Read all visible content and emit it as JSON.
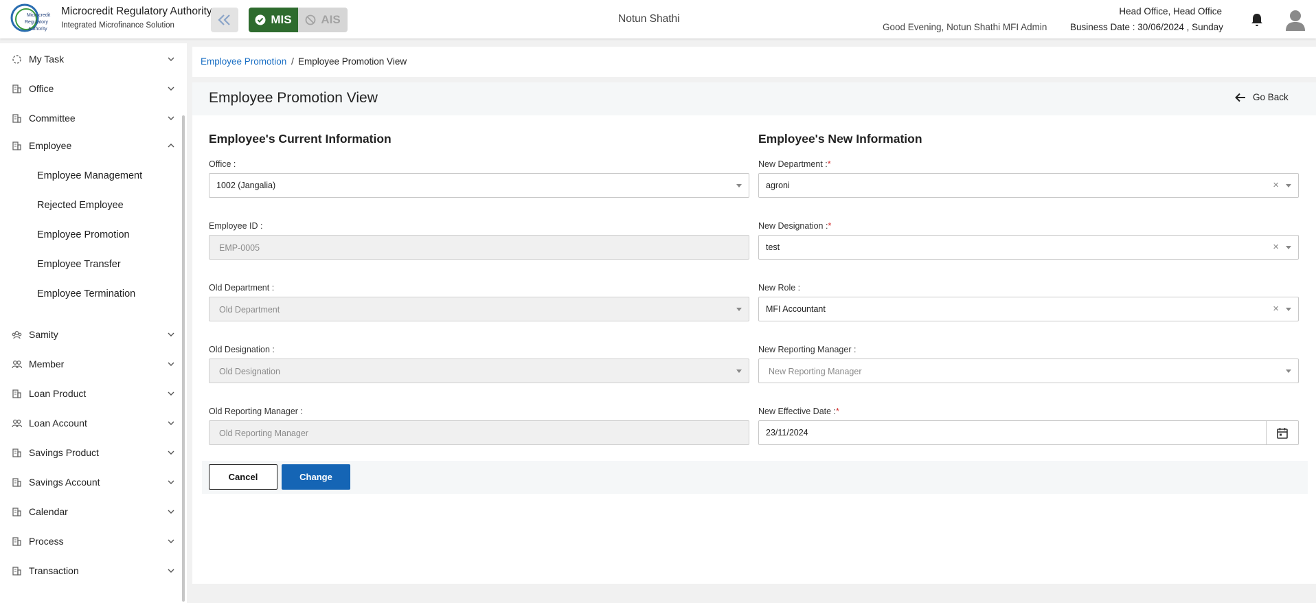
{
  "header": {
    "brand_title": "Microcredit Regulatory Authority",
    "brand_subtitle": "Integrated Microfinance Solution",
    "logo_text_line1": "Microcredit",
    "logo_text_line2": "Regulatory",
    "logo_text_line3": "Authority",
    "mode_active": "MIS",
    "mode_inactive": "AIS",
    "org_name": "Notun Shathi",
    "greeting": "Good Evening, Notun Shathi MFI Admin",
    "office": "Head Office, Head Office",
    "business_date": "Business Date : 30/06/2024 , Sunday"
  },
  "sidebar": {
    "items": [
      {
        "label": "My Task",
        "icon": "task-icon"
      },
      {
        "label": "Office",
        "icon": "building-icon"
      },
      {
        "label": "Committee",
        "icon": "building-icon"
      },
      {
        "label": "Employee",
        "icon": "building-icon"
      },
      {
        "label": "Samity",
        "icon": "group-icon"
      },
      {
        "label": "Member",
        "icon": "users-icon"
      },
      {
        "label": "Loan Product",
        "icon": "building-icon"
      },
      {
        "label": "Loan Account",
        "icon": "users-icon"
      },
      {
        "label": "Savings Product",
        "icon": "building-icon"
      },
      {
        "label": "Savings Account",
        "icon": "building-icon"
      },
      {
        "label": "Calendar",
        "icon": "building-icon"
      },
      {
        "label": "Process",
        "icon": "building-icon"
      },
      {
        "label": "Transaction",
        "icon": "building-icon"
      }
    ],
    "employee_sub": [
      "Employee Management",
      "Rejected Employee",
      "Employee Promotion",
      "Employee Transfer",
      "Employee Termination"
    ]
  },
  "breadcrumb": {
    "parent": "Employee Promotion",
    "separator": "/",
    "current": "Employee Promotion View"
  },
  "page": {
    "title": "Employee Promotion View",
    "go_back": "Go Back"
  },
  "current_info": {
    "title": "Employee's Current Information",
    "office_label": "Office :",
    "office_value": "1002 (Jangalia)",
    "employee_id_label": "Employee ID :",
    "employee_id_value": "EMP-0005",
    "old_department_label": "Old Department :",
    "old_department_placeholder": "Old Department",
    "old_designation_label": "Old Designation :",
    "old_designation_placeholder": "Old Designation",
    "old_manager_label": "Old Reporting Manager :",
    "old_manager_placeholder": "Old Reporting Manager"
  },
  "new_info": {
    "title": "Employee's New Information",
    "department_label": "New Department :",
    "department_value": "agroni",
    "designation_label": "New Designation :",
    "designation_value": "test",
    "role_label": "New Role :",
    "role_value": "MFI Accountant",
    "manager_label": "New Reporting Manager :",
    "manager_placeholder": "New Reporting Manager",
    "effective_date_label": "New Effective Date :",
    "effective_date_value": "23/11/2024",
    "required_mark": "*",
    "clear_symbol": "×"
  },
  "actions": {
    "cancel": "Cancel",
    "change": "Change"
  },
  "colors": {
    "primary_blue": "#1565b5",
    "mis_green": "#2e6b2e",
    "link_blue": "#1a6fc4",
    "required_red": "#d32f2f"
  }
}
